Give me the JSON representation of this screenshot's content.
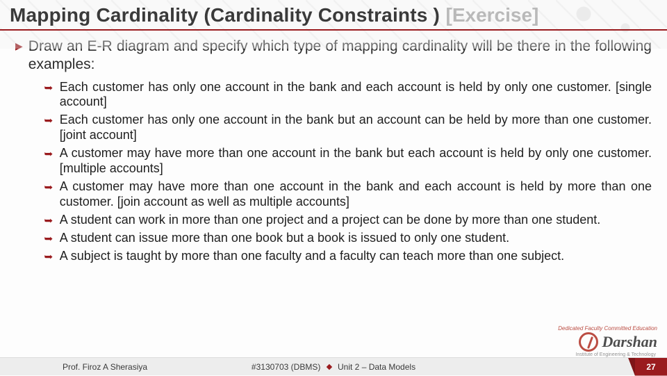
{
  "title": {
    "main": "Mapping Cardinality (Cardinality Constraints  )",
    "tag": "[Exercise]"
  },
  "intro": "Draw an E-R diagram and specify which type of mapping cardinality will be there in the following examples:",
  "items": [
    "Each customer has only one account in the bank and each account is held by only one customer. [single account]",
    "Each customer has only one account in the bank but an account can be held by more than one customer. [joint account]",
    "A customer may have more than one account in the bank but each account is held by only one customer. [multiple accounts]",
    "A customer may have more than one account in the bank and each account is held by more than one customer. [join account as well as multiple accounts]",
    "A student can work in more than one project and a project can be done by more than one student.",
    "A student can issue more than one book but a book is issued to only one student.",
    "A subject is taught by more than one faculty and a faculty can teach more than one subject."
  ],
  "footer": {
    "author": "Prof. Firoz A Sherasiya",
    "course": "#3130703 (DBMS)",
    "unit": "Unit 2 – Data Models",
    "page": "27"
  },
  "logo": {
    "word": "Darshan",
    "tagline": "Dedicated Faculty Committed Education",
    "subtitle": "Institute of Engineering & Technology"
  }
}
